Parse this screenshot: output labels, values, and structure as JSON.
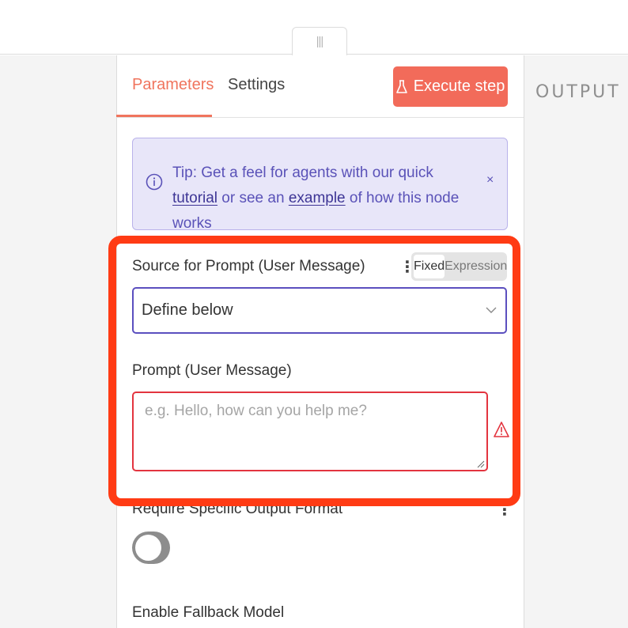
{
  "tabs": {
    "parameters": "Parameters",
    "settings": "Settings"
  },
  "execute_button": {
    "label": "Execute step",
    "icon": "flask-icon"
  },
  "output": {
    "label": "OUTPUT"
  },
  "tip": {
    "part1": "Tip: Get a feel for agents with our quick ",
    "link1": "tutorial",
    "part2": " or see an ",
    "link2": "example",
    "part3": " of how this node works",
    "close": "×"
  },
  "source_prompt": {
    "label": "Source for Prompt (User Message)",
    "mode_fixed": "Fixed",
    "mode_expression": "Expression",
    "selected": "Define below"
  },
  "prompt": {
    "label": "Prompt (User Message)",
    "placeholder": "e.g. Hello, how can you help me?"
  },
  "output_format": {
    "label": "Require Specific Output Format",
    "enabled": false
  },
  "fallback": {
    "label": "Enable Fallback Model"
  },
  "colors": {
    "accent": "#f26b5a",
    "tip_bg": "#e8e6f9",
    "highlight": "#ff3b14",
    "error": "#e3343f"
  }
}
